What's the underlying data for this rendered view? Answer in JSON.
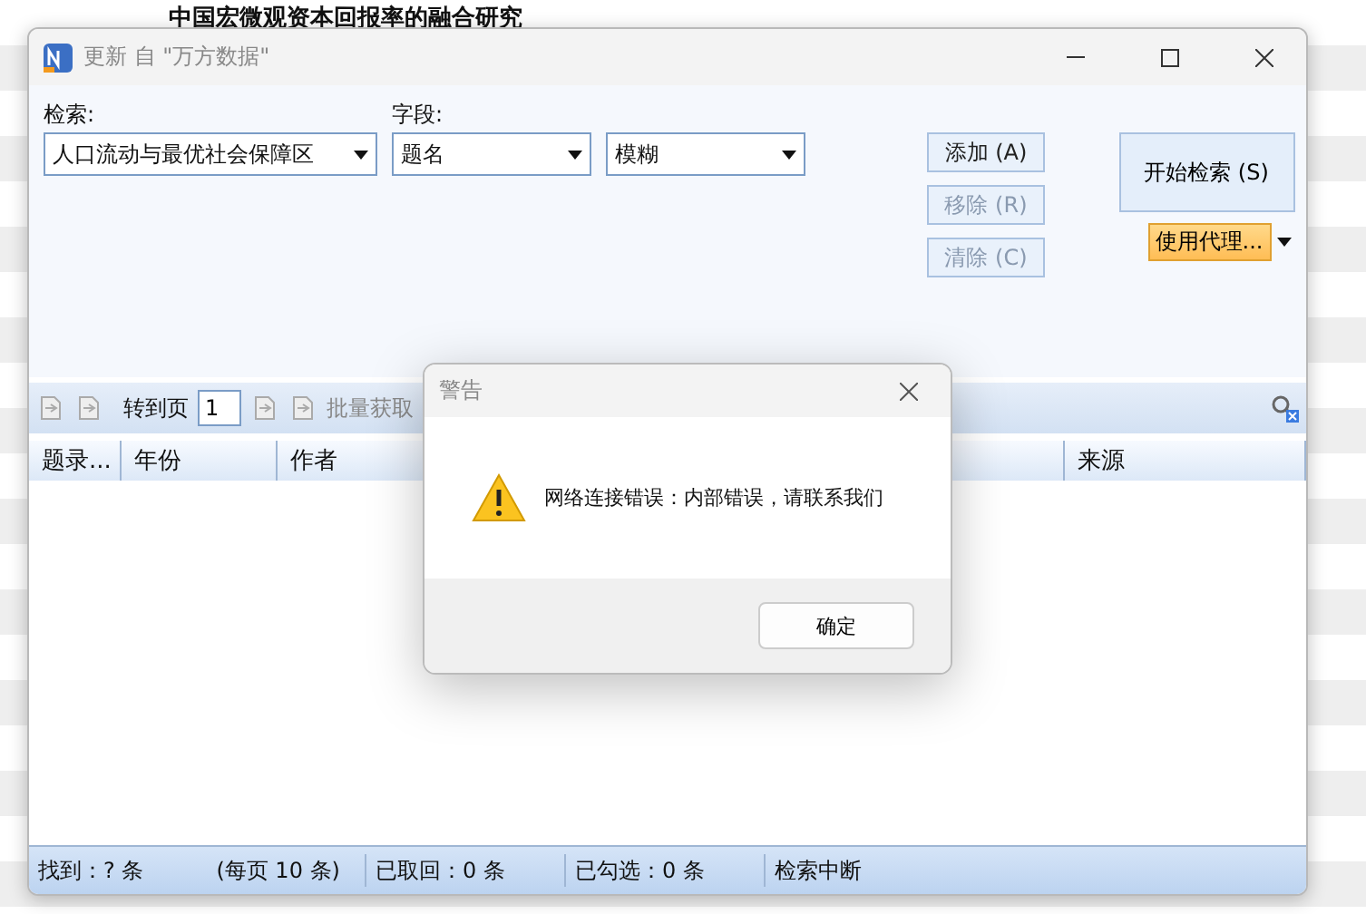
{
  "background": {
    "title": "中国宏微观资本回报率的融合研究"
  },
  "window": {
    "title": "更新 自 \"万方数据\""
  },
  "search": {
    "label": "检索:",
    "query": "人口流动与最优社会保障区",
    "field_label": "字段:",
    "field": "题名",
    "mode": "模糊"
  },
  "buttons": [
    {
      "label": "添加 (A)",
      "disabled": false
    },
    {
      "label": "移除 (R)",
      "disabled": true
    },
    {
      "label": "清除 (C)",
      "disabled": true
    }
  ],
  "start_button": "开始检索 (S)",
  "proxy_button": "使用代理...",
  "toolbar": {
    "page_label": "转到页",
    "page": "1",
    "batch": "批量获取"
  },
  "columns": [
    "题录...",
    "年份",
    "作者",
    "来源"
  ],
  "status_bar": [
    "找到：? 条",
    "(每页 10 条)",
    "已取回：0 条",
    "已勾选：0 条",
    "检索中断"
  ],
  "dialog": {
    "title": "警告",
    "message": "网络连接错误：内部错误，请联系我们",
    "ok": "确定"
  }
}
